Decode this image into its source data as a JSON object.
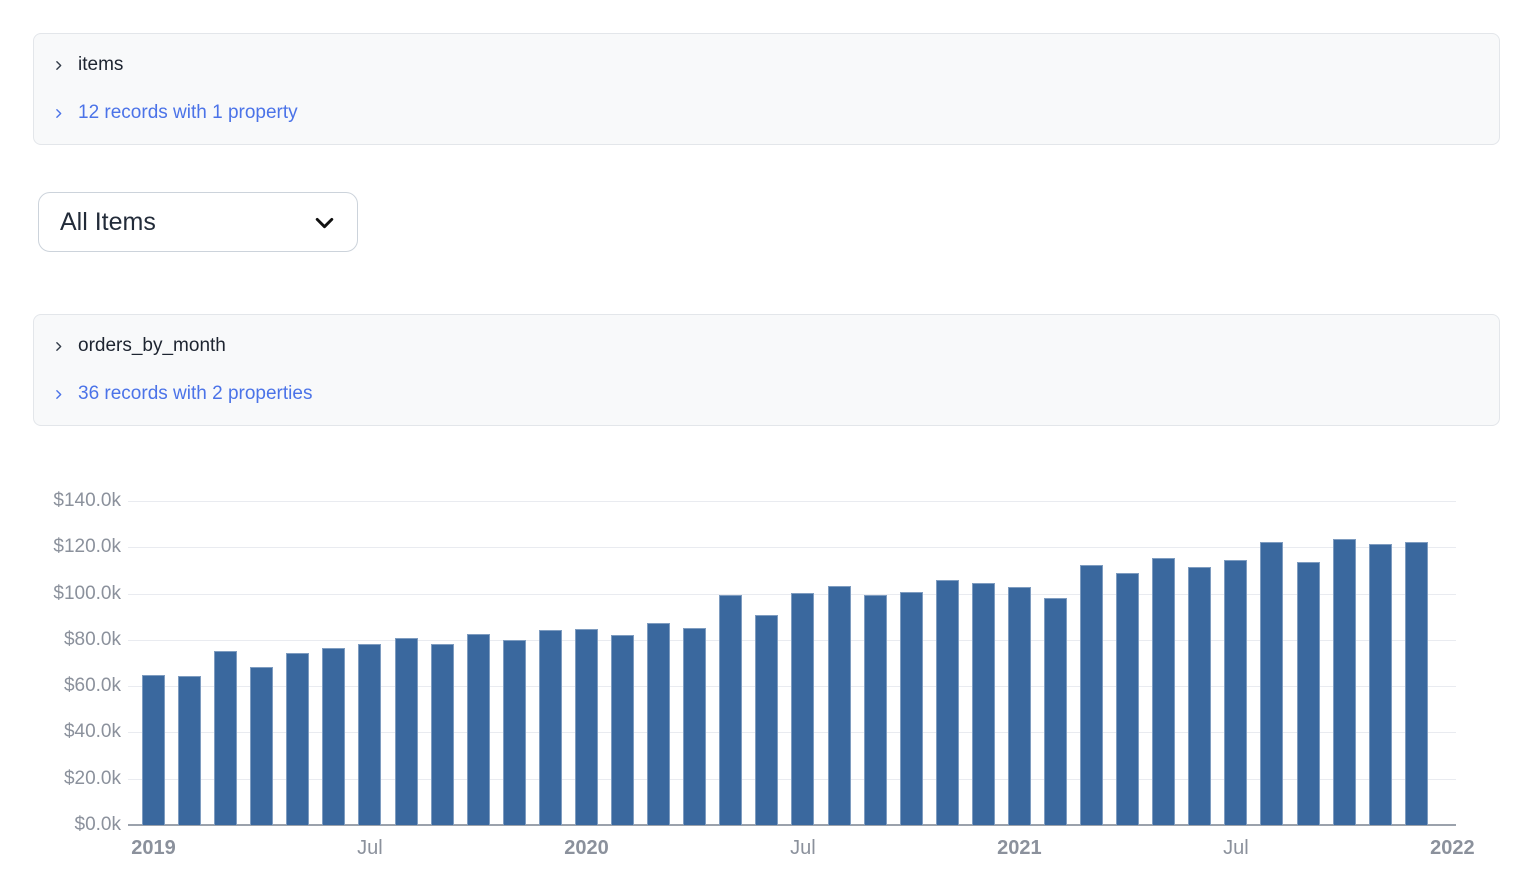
{
  "panels": [
    {
      "title": "items",
      "link_label": "12 records with 1 property"
    },
    {
      "title": "orders_by_month",
      "link_label": "36 records with 2 properties"
    }
  ],
  "dropdown": {
    "value": "All Items"
  },
  "colors": {
    "bar": "#3a689e",
    "link": "#4b73e8",
    "panel_bg": "#f8f9fa",
    "panel_border": "#e3e6ea",
    "axis_text": "#8b919c",
    "gridline": "#e9ebf0",
    "axis_line": "#9ba2ac"
  },
  "chart_data": {
    "type": "bar",
    "title": "",
    "xlabel": "",
    "ylabel": "",
    "unit": "USD thousands (axis formatted as $N.0k)",
    "ylim": [
      0,
      140
    ],
    "grid": true,
    "legend": false,
    "categories": [
      "2019-01",
      "2019-02",
      "2019-03",
      "2019-04",
      "2019-05",
      "2019-06",
      "2019-07",
      "2019-08",
      "2019-09",
      "2019-10",
      "2019-11",
      "2019-12",
      "2020-01",
      "2020-02",
      "2020-03",
      "2020-04",
      "2020-05",
      "2020-06",
      "2020-07",
      "2020-08",
      "2020-09",
      "2020-10",
      "2020-11",
      "2020-12",
      "2021-01",
      "2021-02",
      "2021-03",
      "2021-04",
      "2021-05",
      "2021-06",
      "2021-07",
      "2021-08",
      "2021-09",
      "2021-10",
      "2021-11",
      "2021-12"
    ],
    "values": [
      65.0,
      64.4,
      75.3,
      68.2,
      74.3,
      76.4,
      78.3,
      80.9,
      78.0,
      82.6,
      80.1,
      84.1,
      84.7,
      81.9,
      87.4,
      85.1,
      99.5,
      90.6,
      100.4,
      103.1,
      99.4,
      100.5,
      106.0,
      104.6,
      102.8,
      98.0,
      112.4,
      108.9,
      115.5,
      111.4,
      114.7,
      122.5,
      113.7,
      123.4,
      121.5,
      122.5
    ],
    "y_tick_labels": [
      "$0.0k",
      "$20.0k",
      "$40.0k",
      "$60.0k",
      "$80.0k",
      "$100.0k",
      "$120.0k",
      "$140.0k"
    ],
    "x_ticks": [
      {
        "slot": 0,
        "label": "2019",
        "bold": true
      },
      {
        "slot": 6,
        "label": "Jul",
        "bold": false
      },
      {
        "slot": 12,
        "label": "2020",
        "bold": true
      },
      {
        "slot": 18,
        "label": "Jul",
        "bold": false
      },
      {
        "slot": 24,
        "label": "2021",
        "bold": true
      },
      {
        "slot": 30,
        "label": "Jul",
        "bold": false
      },
      {
        "slot": 36,
        "label": "2022",
        "bold": true
      }
    ]
  }
}
